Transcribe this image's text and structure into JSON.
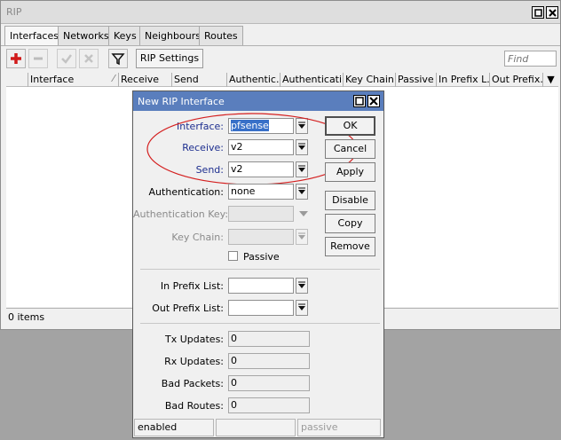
{
  "window": {
    "title": "RIP",
    "tabs": [
      {
        "label": "Interfaces",
        "active": true
      },
      {
        "label": "Networks"
      },
      {
        "label": "Keys"
      },
      {
        "label": "Neighbours"
      },
      {
        "label": "Routes"
      }
    ],
    "toolbar": {
      "add_icon": "plus-icon",
      "remove_icon": "minus-icon",
      "enable_icon": "check-icon",
      "disable_icon": "x-icon",
      "filter_icon": "funnel-icon",
      "rip_settings_label": "RIP Settings",
      "find_placeholder": "Find"
    },
    "columns": [
      "Interface",
      "Receive",
      "Send",
      "Authentic...",
      "Authenticati...",
      "Key Chain",
      "Passive",
      "In Prefix L...",
      "Out Prefix..."
    ],
    "status": "0 items"
  },
  "dialog": {
    "title": "New RIP Interface",
    "fields": {
      "interface": {
        "label": "Interface:",
        "value": "pfsense"
      },
      "receive": {
        "label": "Receive:",
        "value": "v2"
      },
      "send": {
        "label": "Send:",
        "value": "v2"
      },
      "authentication": {
        "label": "Authentication:",
        "value": "none"
      },
      "authentication_key": {
        "label": "Authentication Key:",
        "value": ""
      },
      "key_chain": {
        "label": "Key Chain:",
        "value": ""
      },
      "passive": {
        "label": "Passive",
        "checked": false
      },
      "in_prefix_list": {
        "label": "In Prefix List:",
        "value": ""
      },
      "out_prefix_list": {
        "label": "Out Prefix List:",
        "value": ""
      },
      "tx_updates": {
        "label": "Tx Updates:",
        "value": "0"
      },
      "rx_updates": {
        "label": "Rx Updates:",
        "value": "0"
      },
      "bad_packets": {
        "label": "Bad Packets:",
        "value": "0"
      },
      "bad_routes": {
        "label": "Bad Routes:",
        "value": "0"
      }
    },
    "buttons": {
      "ok": "OK",
      "cancel": "Cancel",
      "apply": "Apply",
      "disable": "Disable",
      "copy": "Copy",
      "remove": "Remove"
    },
    "status": {
      "left": "enabled",
      "middle": "",
      "right": "passive"
    }
  },
  "colors": {
    "dialog_title": "#5a7ebd",
    "highlight_ellipse": "#d42020",
    "field_label_blue": "#1d2e8f"
  }
}
